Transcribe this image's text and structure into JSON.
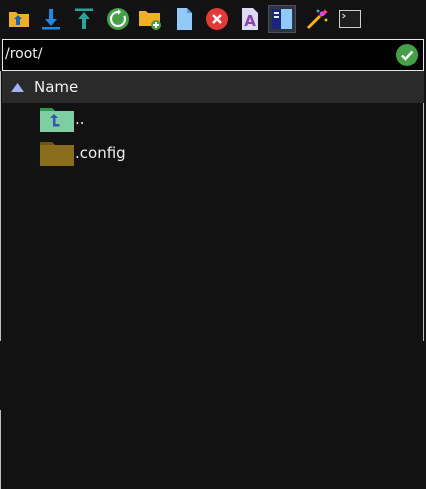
{
  "toolbar": {
    "buttons": [
      {
        "name": "up-folder",
        "icon": "folder-up-icon",
        "color": "#f0b020"
      },
      {
        "name": "download",
        "icon": "download-icon",
        "color": "#1e88e5"
      },
      {
        "name": "upload",
        "icon": "upload-icon",
        "color": "#26a69a"
      },
      {
        "name": "refresh",
        "icon": "refresh-icon",
        "color": "#43a047"
      },
      {
        "name": "new-folder",
        "icon": "folder-plus-icon",
        "color": "#f0b020"
      },
      {
        "name": "new-file",
        "icon": "file-icon",
        "color": "#90caf9"
      },
      {
        "name": "delete",
        "icon": "close-circle-icon",
        "color": "#e53935"
      },
      {
        "name": "rename",
        "icon": "rename-icon",
        "color": "#7e57c2"
      },
      {
        "name": "toggle-panel",
        "icon": "panel-icon",
        "color": "#90caf9",
        "active": true
      },
      {
        "name": "magic",
        "icon": "magic-wand-icon",
        "color": "#e040fb"
      },
      {
        "name": "terminal",
        "icon": "terminal-icon",
        "color": "#cfcfcf"
      }
    ]
  },
  "path": {
    "value": "/root/"
  },
  "table": {
    "column_header": "Name",
    "sort": "ascending",
    "rows": [
      {
        "name": "..",
        "icon": "folder-up-icon",
        "color": "#7dcea0"
      },
      {
        "name": ".config",
        "icon": "folder-icon",
        "color": "#8a6d1a"
      }
    ]
  }
}
